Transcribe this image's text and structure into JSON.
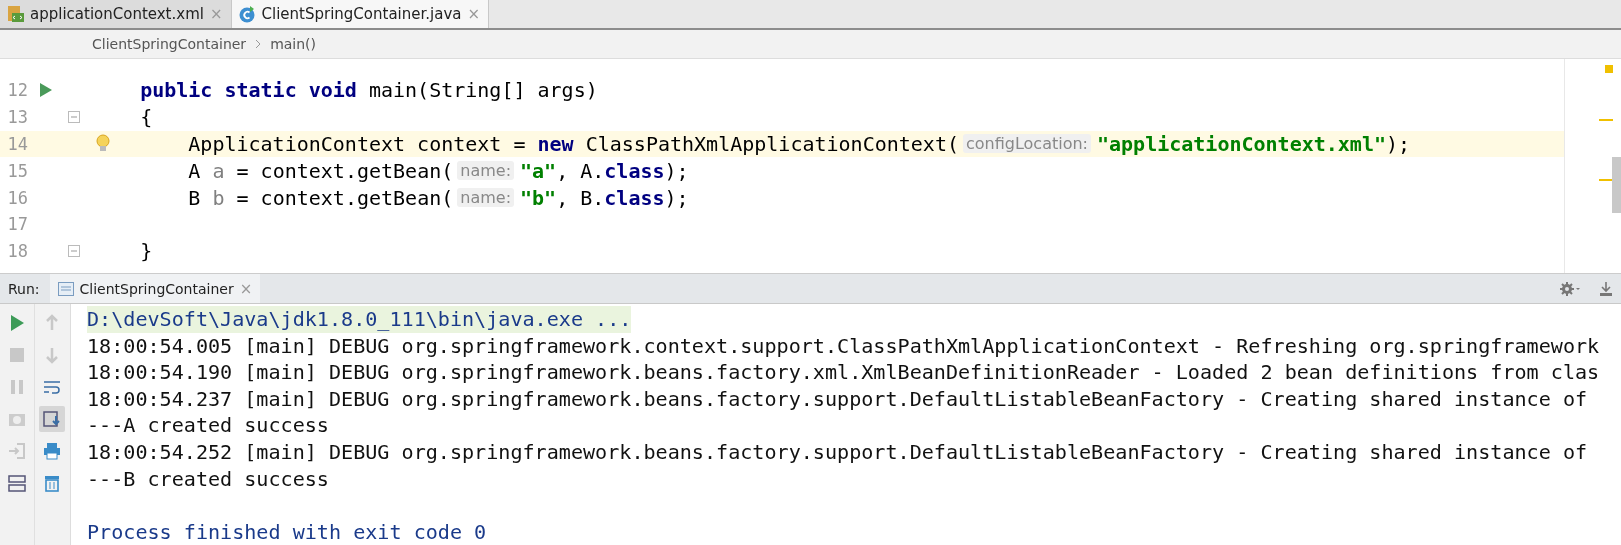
{
  "tabs": [
    {
      "label": "applicationContext.xml",
      "kind": "xml",
      "selected": false,
      "close": "×"
    },
    {
      "label": "ClientSpringContainer.java",
      "kind": "java",
      "selected": true,
      "close": "×"
    }
  ],
  "breadcrumb": [
    "ClientSpringContainer",
    "main()"
  ],
  "editor": {
    "lines": [
      {
        "number": "12",
        "run_marker": true,
        "fold": false,
        "current": false,
        "bulb": false,
        "tokens": [
          {
            "text": "    public static void",
            "kind": "keyword"
          },
          {
            "text": " main(String[] args)",
            "kind": "plain"
          }
        ]
      },
      {
        "number": "13",
        "run_marker": false,
        "fold": true,
        "current": false,
        "bulb": false,
        "tokens": [
          {
            "text": "    {",
            "kind": "plain"
          }
        ]
      },
      {
        "number": "14",
        "run_marker": false,
        "fold": false,
        "current": true,
        "bulb": true,
        "tokens": [
          {
            "text": "        ApplicationContext context = ",
            "kind": "plain"
          },
          {
            "text": "new",
            "kind": "keyword"
          },
          {
            "text": " ClassPathXmlApplicationContext(",
            "kind": "plain"
          },
          {
            "text": "configLocation:",
            "kind": "hint"
          },
          {
            "text": "\"applicationContext.xml\"",
            "kind": "string"
          },
          {
            "text": ");",
            "kind": "plain"
          }
        ]
      },
      {
        "number": "15",
        "run_marker": false,
        "fold": false,
        "current": false,
        "bulb": false,
        "tokens": [
          {
            "text": "        A ",
            "kind": "plain"
          },
          {
            "text": "a",
            "kind": "unused"
          },
          {
            "text": " = context.getBean(",
            "kind": "plain"
          },
          {
            "text": "name:",
            "kind": "hint"
          },
          {
            "text": "\"a\"",
            "kind": "string"
          },
          {
            "text": ", A.",
            "kind": "plain"
          },
          {
            "text": "class",
            "kind": "keyword"
          },
          {
            "text": ");",
            "kind": "plain"
          }
        ]
      },
      {
        "number": "16",
        "run_marker": false,
        "fold": false,
        "current": false,
        "bulb": false,
        "tokens": [
          {
            "text": "        B ",
            "kind": "plain"
          },
          {
            "text": "b",
            "kind": "unused"
          },
          {
            "text": " = context.getBean(",
            "kind": "plain"
          },
          {
            "text": "name:",
            "kind": "hint"
          },
          {
            "text": "\"b\"",
            "kind": "string"
          },
          {
            "text": ", B.",
            "kind": "plain"
          },
          {
            "text": "class",
            "kind": "keyword"
          },
          {
            "text": ");",
            "kind": "plain"
          }
        ]
      },
      {
        "number": "17",
        "run_marker": false,
        "fold": false,
        "current": false,
        "bulb": false
      },
      {
        "number": "18",
        "run_marker": false,
        "fold": true,
        "current": false,
        "bulb": false,
        "tokens": [
          {
            "text": "    }",
            "kind": "plain"
          }
        ]
      }
    ]
  },
  "run_panel": {
    "label": "Run:",
    "tab": {
      "label": "ClientSpringContainer",
      "close": "×"
    },
    "scroll_to_end_on": true,
    "console_blocks": [
      {
        "lines": [
          {
            "text": "D:\\devSoft\\Java\\jdk1.8.0_111\\bin\\java.exe ...",
            "kind": "command"
          },
          {
            "text": "18:00:54.005 [main] DEBUG org.springframework.context.support.ClassPathXmlApplicationContext - Refreshing org.springframework",
            "kind": "output"
          },
          {
            "text": "18:00:54.190 [main] DEBUG org.springframework.beans.factory.xml.XmlBeanDefinitionReader - Loaded 2 bean definitions from clas",
            "kind": "output"
          },
          {
            "text": "18:00:54.237 [main] DEBUG org.springframework.beans.factory.support.DefaultListableBeanFactory - Creating shared instance of",
            "kind": "output"
          },
          {
            "text": "---A created success",
            "kind": "output"
          },
          {
            "text": "18:00:54.252 [main] DEBUG org.springframework.beans.factory.support.DefaultListableBeanFactory - Creating shared instance of",
            "kind": "output"
          },
          {
            "text": "---B created success",
            "kind": "output"
          }
        ]
      },
      {
        "lines": [
          {
            "text": "Process finished with exit code 0",
            "kind": "result"
          }
        ]
      }
    ]
  }
}
